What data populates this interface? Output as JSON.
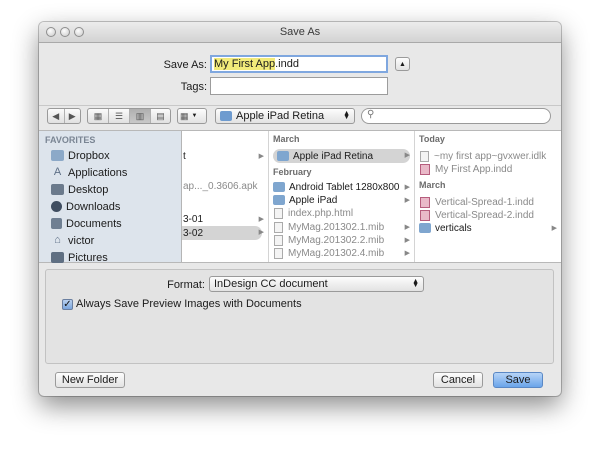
{
  "window": {
    "title": "Save As"
  },
  "save_as": {
    "label": "Save As:",
    "filename_selected": "My First App",
    "filename_ext": ".indd"
  },
  "tags": {
    "label": "Tags:",
    "value": ""
  },
  "toolbar": {
    "location": "Apple iPad Retina"
  },
  "sidebar": {
    "heading": "FAVORITES",
    "items": [
      {
        "label": "Dropbox",
        "icon": "dropbox-folder-icon"
      },
      {
        "label": "Applications",
        "icon": "applications-icon"
      },
      {
        "label": "Desktop",
        "icon": "desktop-icon"
      },
      {
        "label": "Downloads",
        "icon": "downloads-icon"
      },
      {
        "label": "Documents",
        "icon": "documents-icon"
      },
      {
        "label": "victor",
        "icon": "home-icon"
      },
      {
        "label": "Pictures",
        "icon": "pictures-icon"
      }
    ]
  },
  "columns": {
    "col1": {
      "rows": [
        "t",
        "ap..._0.3606.apk",
        "3-01",
        "3-02"
      ]
    },
    "col2": {
      "heading_march": "March",
      "march_items": [
        "Apple iPad Retina"
      ],
      "heading_feb": "February",
      "feb_items": [
        "Android Tablet 1280x800",
        "Apple iPad",
        "index.php.html",
        "MyMag.201302.1.mib",
        "MyMag.201302.2.mib",
        "MyMag.201302.4.mib"
      ]
    },
    "col3": {
      "heading_today": "Today",
      "today_items": [
        "~my first app~gvxwer.idlk",
        "My First App.indd"
      ],
      "heading_march": "March",
      "march_items": [
        "Vertical-Spread-1.indd",
        "Vertical-Spread-2.indd",
        "verticals"
      ]
    }
  },
  "format": {
    "label": "Format:",
    "value": "InDesign CC document"
  },
  "preview_checkbox": {
    "label": "Always Save Preview Images with Documents",
    "checked": true
  },
  "buttons": {
    "new_folder": "New Folder",
    "cancel": "Cancel",
    "save": "Save"
  }
}
